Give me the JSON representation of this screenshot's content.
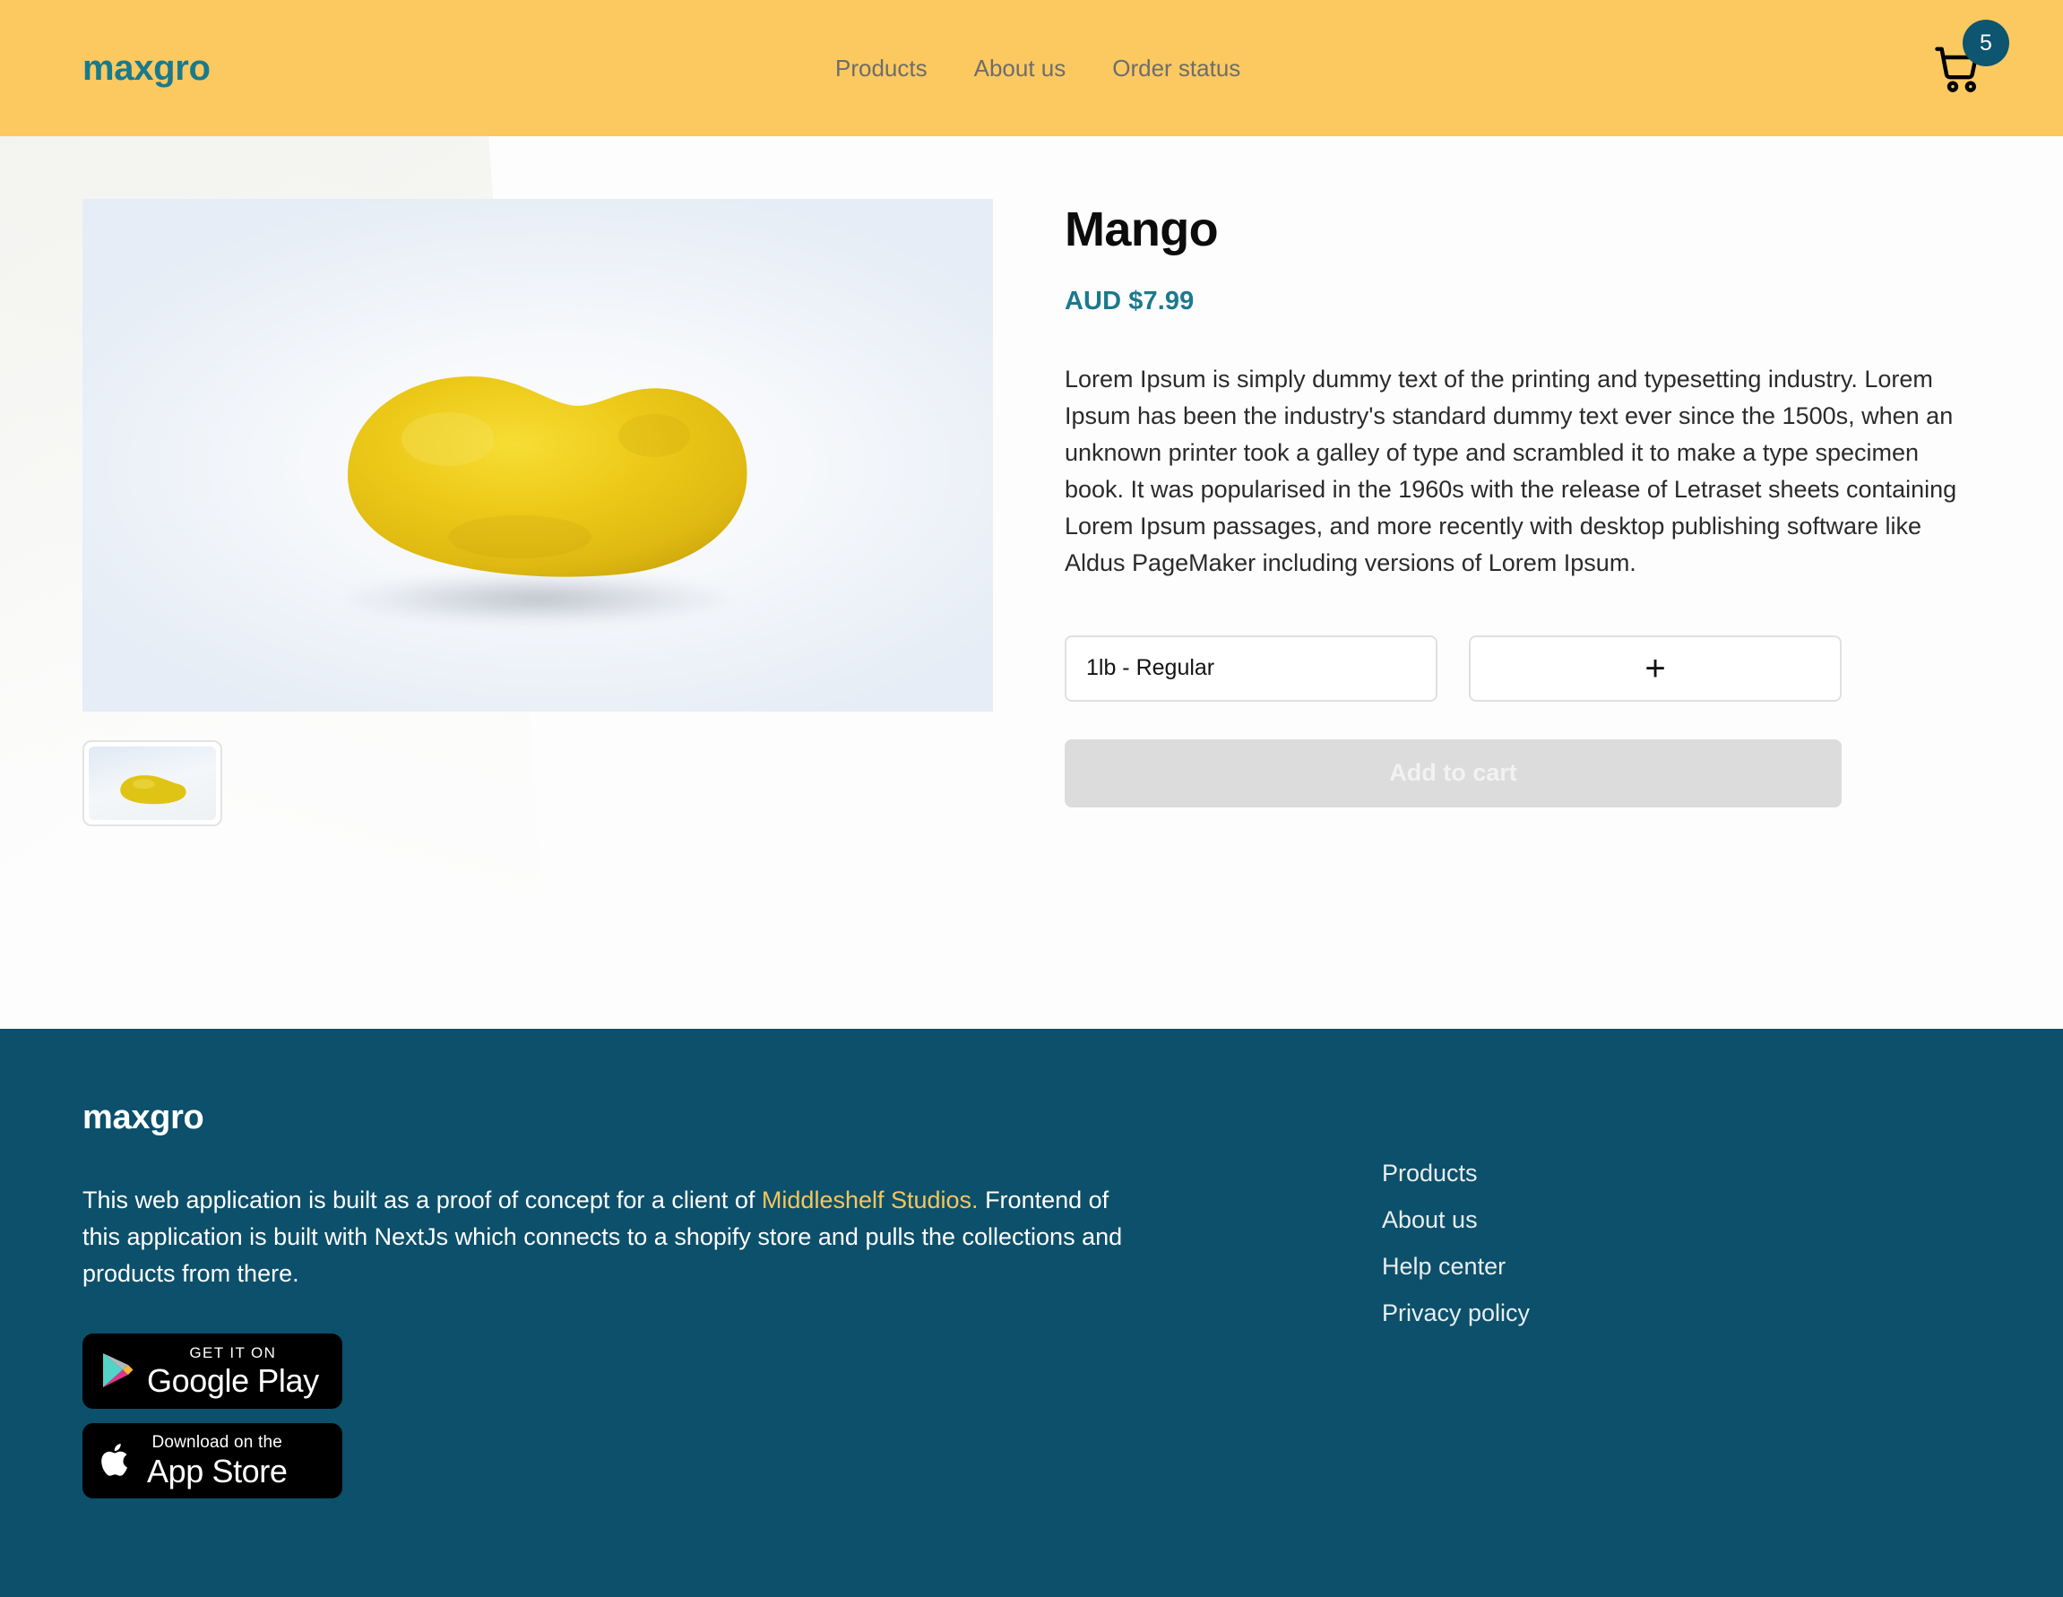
{
  "header": {
    "logo": "maxgro",
    "nav": [
      {
        "label": "Products"
      },
      {
        "label": "About us"
      },
      {
        "label": "Order status"
      }
    ],
    "cart": {
      "icon": "shopping-cart-icon",
      "count": "5"
    }
  },
  "product": {
    "title": "Mango",
    "price": "AUD $7.99",
    "description": "Lorem Ipsum is simply dummy text of the printing and typesetting industry. Lorem Ipsum has been the industry's standard dummy text ever since the 1500s, when an unknown printer took a galley of type and scrambled it to make a type specimen book. It was popularised in the 1960s with the release of Letraset sheets containing Lorem Ipsum passages, and more recently with desktop publishing software like Aldus PageMaker including versions of Lorem Ipsum.",
    "variant_selected": "1lb - Regular",
    "quantity_increment_label": "+",
    "add_to_cart_label": "Add to cart",
    "image_alt": "mango-product-image",
    "thumbnail_alt": "mango-thumbnail"
  },
  "footer": {
    "logo": "maxgro",
    "about_part1": "This web application is built as a proof of concept for a client of ",
    "about_link": "Middleshelf Studios.",
    "about_part2": " Frontend of this application is built with NextJs which connects to a shopify store and pulls the collections and products from there.",
    "google_play": {
      "small": "GET IT ON",
      "big": "Google Play"
    },
    "app_store": {
      "small": "Download on the",
      "big": "App Store"
    },
    "links": [
      {
        "label": "Products"
      },
      {
        "label": "About us"
      },
      {
        "label": "Help center"
      },
      {
        "label": "Privacy policy"
      }
    ]
  },
  "colors": {
    "header_bg": "#fbc95f",
    "brand_teal": "#1a7a8c",
    "footer_bg": "#0c506b",
    "badge_bg": "#0e5570",
    "link_yellow": "#f5c65c"
  }
}
